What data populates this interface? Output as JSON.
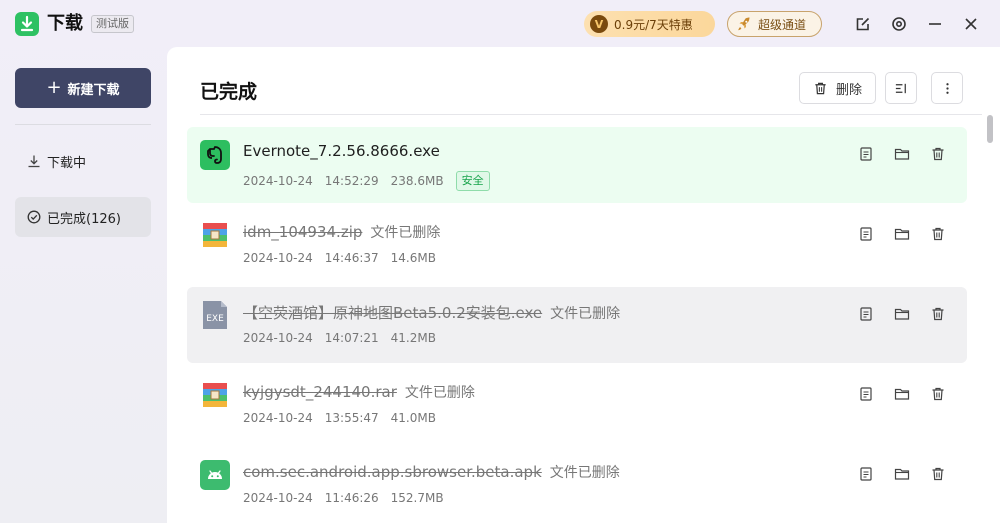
{
  "app": {
    "title": "下载",
    "beta": "测试版"
  },
  "header": {
    "promo_icon": "V",
    "promo_text": "0.9元/7天特惠",
    "speed_text": "超级通道"
  },
  "sidebar": {
    "new_download": "新建下载",
    "items": [
      {
        "label": "下载中",
        "icon": "download-icon"
      },
      {
        "label": "已完成(126)",
        "icon": "check-circle-icon"
      }
    ]
  },
  "main": {
    "title": "已完成",
    "delete_label": "删除",
    "files": [
      {
        "name": "Evernote_7.2.56.8666.exe",
        "date": "2024-10-24",
        "time": "14:52:29",
        "size": "238.6MB",
        "badge": "安全",
        "deleted": false,
        "icon": "evernote-icon"
      },
      {
        "name": "idm_104934.zip",
        "status": "文件已删除",
        "date": "2024-10-24",
        "time": "14:46:37",
        "size": "14.6MB",
        "deleted": true,
        "icon": "zip-icon"
      },
      {
        "name": "【空荧酒馆】原神地图Beta5.0.2安装包.exe",
        "status": "文件已删除",
        "date": "2024-10-24",
        "time": "14:07:21",
        "size": "41.2MB",
        "deleted": true,
        "icon": "exe-icon",
        "icon_label": "EXE"
      },
      {
        "name": "kyjgysdt_244140.rar",
        "status": "文件已删除",
        "date": "2024-10-24",
        "time": "13:55:47",
        "size": "41.0MB",
        "deleted": true,
        "icon": "rar-icon"
      },
      {
        "name": "com.sec.android.app.sbrowser.beta.apk",
        "status": "文件已删除",
        "date": "2024-10-24",
        "time": "11:46:26",
        "size": "152.7MB",
        "deleted": true,
        "icon": "apk-icon"
      }
    ]
  },
  "colors": {
    "accent": "#3f4566",
    "safe_bg": "#ecfdf1",
    "safe_text": "#17a34a",
    "logo": "#2ec163"
  }
}
